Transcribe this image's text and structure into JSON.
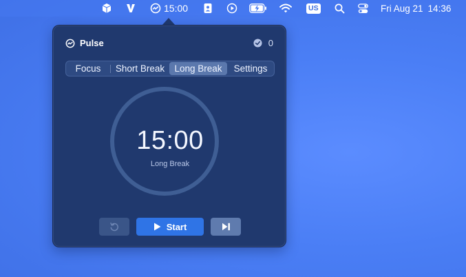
{
  "menubar": {
    "icons": [
      "cube-icon",
      "v-app-icon",
      "pulse-timer-icon",
      "contacts-icon",
      "play-circle-icon",
      "battery-charging-icon",
      "wifi-icon",
      "search-icon",
      "control-center-icon"
    ],
    "timer_text": "15:00",
    "input_source": "US",
    "date": "Fri Aug 21",
    "time": "14:36"
  },
  "popover": {
    "app_name": "Pulse",
    "completed_count": "0",
    "tabs": [
      {
        "label": "Focus",
        "active": false
      },
      {
        "label": "Short Break",
        "active": false
      },
      {
        "label": "Long Break",
        "active": true
      },
      {
        "label": "Settings",
        "active": false
      }
    ],
    "timer": {
      "display": "15:00",
      "mode_label": "Long Break",
      "progress_fraction": 0
    },
    "controls": {
      "start_label": "Start"
    }
  },
  "colors": {
    "desktop": "#4a7ef5",
    "popover_bg": "#20396e",
    "active_tab": "#5b78ad",
    "start_button": "#2f74e6",
    "ring": "#3f5e94"
  }
}
